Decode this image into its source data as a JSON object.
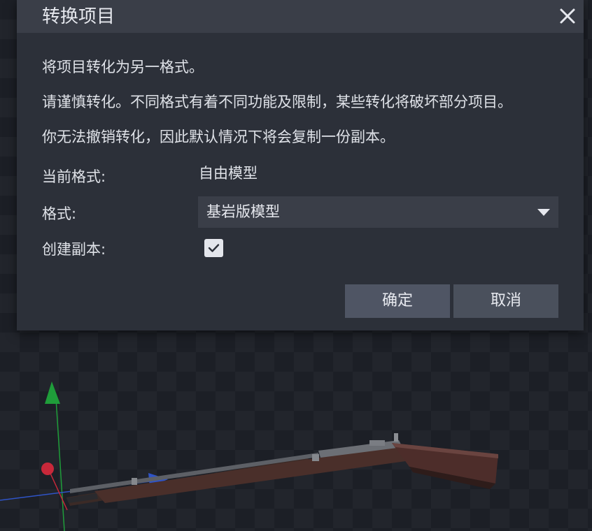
{
  "dialog": {
    "title": "转换项目",
    "messages": [
      "将项目转化为另一格式。",
      "请谨慎转化。不同格式有着不同功能及限制，某些转化将破坏部分项目。",
      "你无法撤销转化，因此默认情况下将会复制一份副本。"
    ],
    "current_format_label": "当前格式:",
    "current_format_value": "自由模型",
    "format_label": "格式:",
    "format_selected": "基岩版模型",
    "create_copy_label": "创建副本:",
    "create_copy_checked": true,
    "confirm_label": "确定",
    "cancel_label": "取消"
  },
  "icons": {
    "close": "close-icon",
    "dropdown": "chevron-down-icon",
    "check": "check-icon"
  },
  "colors": {
    "dialog_bg": "#2c3039",
    "header_bg": "#3a3e48",
    "button_bg": "#4a505c",
    "axis_y": "#1f9d3a",
    "axis_x": "#c8283a",
    "axis_z": "#2f54c8"
  }
}
